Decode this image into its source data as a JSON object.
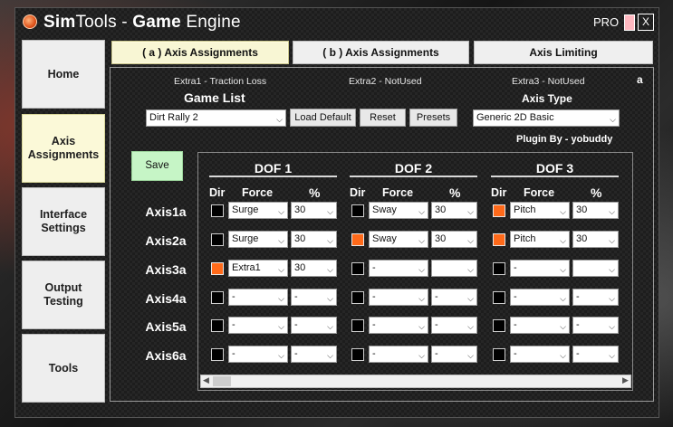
{
  "window": {
    "title_prefix": "Sim",
    "title_mid": "Tools - ",
    "title_bold": "Game",
    "title_suffix": " Engine",
    "pro_label": "PRO",
    "close_label": "X"
  },
  "nav": {
    "items": [
      {
        "label": "Home",
        "active": false
      },
      {
        "label": "Axis Assignments",
        "active": true
      },
      {
        "label": "Interface Settings",
        "active": false
      },
      {
        "label": "Output Testing",
        "active": false
      },
      {
        "label": "Tools",
        "active": false
      }
    ]
  },
  "tabs": [
    {
      "label": "( a ) Axis Assignments",
      "active": true
    },
    {
      "label": "( b ) Axis Assignments",
      "active": false
    },
    {
      "label": "Axis Limiting",
      "active": false
    }
  ],
  "panel": {
    "extra1": "Extra1 - Traction Loss",
    "extra2": "Extra2 - NotUsed",
    "extra3": "Extra3 - NotUsed",
    "corner_label": "a",
    "game_list_label": "Game List",
    "game_selected": "Dirt Rally 2",
    "load_default_label": "Load Default",
    "reset_label": "Reset",
    "presets_label": "Presets",
    "axis_type_label": "Axis Type",
    "axis_type_selected": "Generic 2D Basic",
    "plugin_by": "Plugin By - yobuddy",
    "save_label": "Save"
  },
  "grid": {
    "dof_titles": [
      "DOF 1",
      "DOF 2",
      "DOF 3"
    ],
    "col_dir": "Dir",
    "col_force": "Force",
    "col_percent": "%",
    "axes": [
      {
        "label": "Axis1a",
        "dofs": [
          {
            "dir": false,
            "force": "Surge",
            "pct": "30"
          },
          {
            "dir": false,
            "force": "Sway",
            "pct": "30"
          },
          {
            "dir": true,
            "force": "Pitch",
            "pct": "30"
          }
        ]
      },
      {
        "label": "Axis2a",
        "dofs": [
          {
            "dir": false,
            "force": "Surge",
            "pct": "30"
          },
          {
            "dir": true,
            "force": "Sway",
            "pct": "30"
          },
          {
            "dir": true,
            "force": "Pitch",
            "pct": "30"
          }
        ]
      },
      {
        "label": "Axis3a",
        "dofs": [
          {
            "dir": true,
            "force": "Extra1",
            "pct": "30"
          },
          {
            "dir": false,
            "force": "-",
            "pct": ""
          },
          {
            "dir": false,
            "force": "-",
            "pct": ""
          }
        ]
      },
      {
        "label": "Axis4a",
        "dofs": [
          {
            "dir": false,
            "force": "-",
            "pct": "-"
          },
          {
            "dir": false,
            "force": "-",
            "pct": "-"
          },
          {
            "dir": false,
            "force": "-",
            "pct": "-"
          }
        ]
      },
      {
        "label": "Axis5a",
        "dofs": [
          {
            "dir": false,
            "force": "-",
            "pct": "-"
          },
          {
            "dir": false,
            "force": "-",
            "pct": "-"
          },
          {
            "dir": false,
            "force": "-",
            "pct": "-"
          }
        ]
      },
      {
        "label": "Axis6a",
        "dofs": [
          {
            "dir": false,
            "force": "-",
            "pct": "-"
          },
          {
            "dir": false,
            "force": "-",
            "pct": "-"
          },
          {
            "dir": false,
            "force": "-",
            "pct": "-"
          }
        ]
      }
    ]
  },
  "colors": {
    "dir_on": "#ff6a1a",
    "save_bg": "#c6f5c6",
    "active_tab": "#f8f6d4"
  },
  "icons": {
    "app": "simtools-logo-icon",
    "dropdown": "chevron-down-icon",
    "scroll_left": "arrow-left-icon",
    "scroll_right": "arrow-right-icon"
  }
}
